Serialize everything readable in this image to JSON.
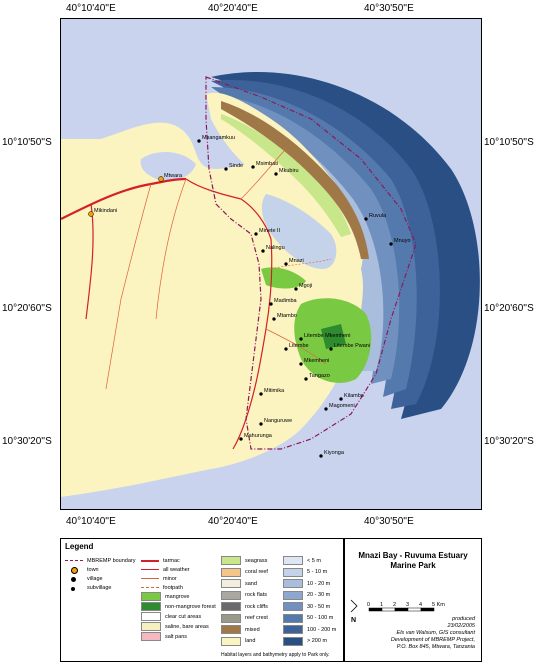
{
  "coordinates": {
    "top": [
      "40°10'40''E",
      "40°20'40''E",
      "40°30'50''E"
    ],
    "bottom": [
      "40°10'40''E",
      "40°20'40''E",
      "40°30'50''E"
    ],
    "left": [
      "10°10'50''S",
      "10°20'60''S",
      "10°30'20''S"
    ],
    "right": [
      "10°10'50''S",
      "10°20'60''S",
      "10°30'20''S"
    ]
  },
  "places": {
    "towns": [
      "Mtwara",
      "Mikindani"
    ],
    "villages": [
      "Msangamkuu",
      "Sinde",
      "Msimbati",
      "Minete II",
      "Nalingu",
      "Mnazi",
      "Mgoji",
      "Madimba",
      "Mtambo",
      "Litembe",
      "Litembe Mkemheni",
      "Mkemheni",
      "Tangazo",
      "Litembe Pwani",
      "Magomeni",
      "Kilambo",
      "Nanguruwe",
      "Mahurunga",
      "Mitimika",
      "Kiyonga",
      "Mkubiru",
      "Ruvula",
      "Mnuyo"
    ]
  },
  "legend": {
    "title": "Legend",
    "col1": [
      {
        "label": "MBREMP boundary",
        "symbol": "boundary-line",
        "color": "#8b1a5a"
      },
      {
        "label": "town",
        "symbol": "town-dot",
        "color": "#f0a000"
      },
      {
        "label": "village",
        "symbol": "village-dot",
        "color": "#000000"
      },
      {
        "label": "subvillage",
        "symbol": "subvillage-dot",
        "color": "#000000"
      }
    ],
    "col2": [
      {
        "label": "tarmac",
        "symbol": "road-tarmac",
        "color": "#d4202a"
      },
      {
        "label": "all weather",
        "symbol": "road-allweather",
        "color": "#d4202a"
      },
      {
        "label": "minor",
        "symbol": "road-minor",
        "color": "#e0603a"
      },
      {
        "label": "footpath",
        "symbol": "road-footpath",
        "color": "#e0603a"
      }
    ],
    "landcover": [
      {
        "label": "mangrove",
        "color": "#7ac943"
      },
      {
        "label": "non-mangrove forest",
        "color": "#2e8b2e"
      },
      {
        "label": "clear cut areas",
        "color": "#ffffff"
      },
      {
        "label": "saline, bare areas",
        "color": "#f4f0c0"
      },
      {
        "label": "salt pans",
        "color": "#f4b8c0"
      }
    ],
    "habitat": [
      {
        "label": "seagrass",
        "color": "#c8e68a"
      },
      {
        "label": "coral reef",
        "color": "#f6c58a"
      },
      {
        "label": "sand",
        "color": "#f2eddc"
      },
      {
        "label": "rock flats",
        "color": "#a8a8a0"
      },
      {
        "label": "rock cliffs",
        "color": "#6a6a6a"
      },
      {
        "label": "reef crest",
        "color": "#9a9a8a"
      },
      {
        "label": "mixed",
        "color": "#a07848"
      },
      {
        "label": "land",
        "color": "#fbf3c0"
      }
    ],
    "depth": [
      {
        "label": "< 5 m",
        "color": "#dde6f4"
      },
      {
        "label": "5 - 10 m",
        "color": "#c5d3ea"
      },
      {
        "label": "10 - 20 m",
        "color": "#a9bddc"
      },
      {
        "label": "20 - 30 m",
        "color": "#8ea7cf"
      },
      {
        "label": "30 - 50 m",
        "color": "#7090bf"
      },
      {
        "label": "50 - 100 m",
        "color": "#5479ad"
      },
      {
        "label": "100 - 200 m",
        "color": "#3d629a"
      },
      {
        "label": "> 200 m",
        "color": "#2a4f85"
      }
    ],
    "note": "Habitat layers and bathymetry apply to Park only."
  },
  "title": {
    "line1": "Mnazi Bay - Ruvuma Estuary",
    "line2": "Marine Park"
  },
  "scalebar": {
    "labels": [
      "0",
      "1",
      "2",
      "3",
      "4",
      "5 Km"
    ],
    "north": "N"
  },
  "credits": {
    "line1": "produced",
    "line2": "23/02/2005",
    "line3": "Els van Walsum, GIS consultant",
    "line4": "Development of MBREMP Project,",
    "line5": "P.O. Box 845, Mtwara, Tanzania"
  }
}
